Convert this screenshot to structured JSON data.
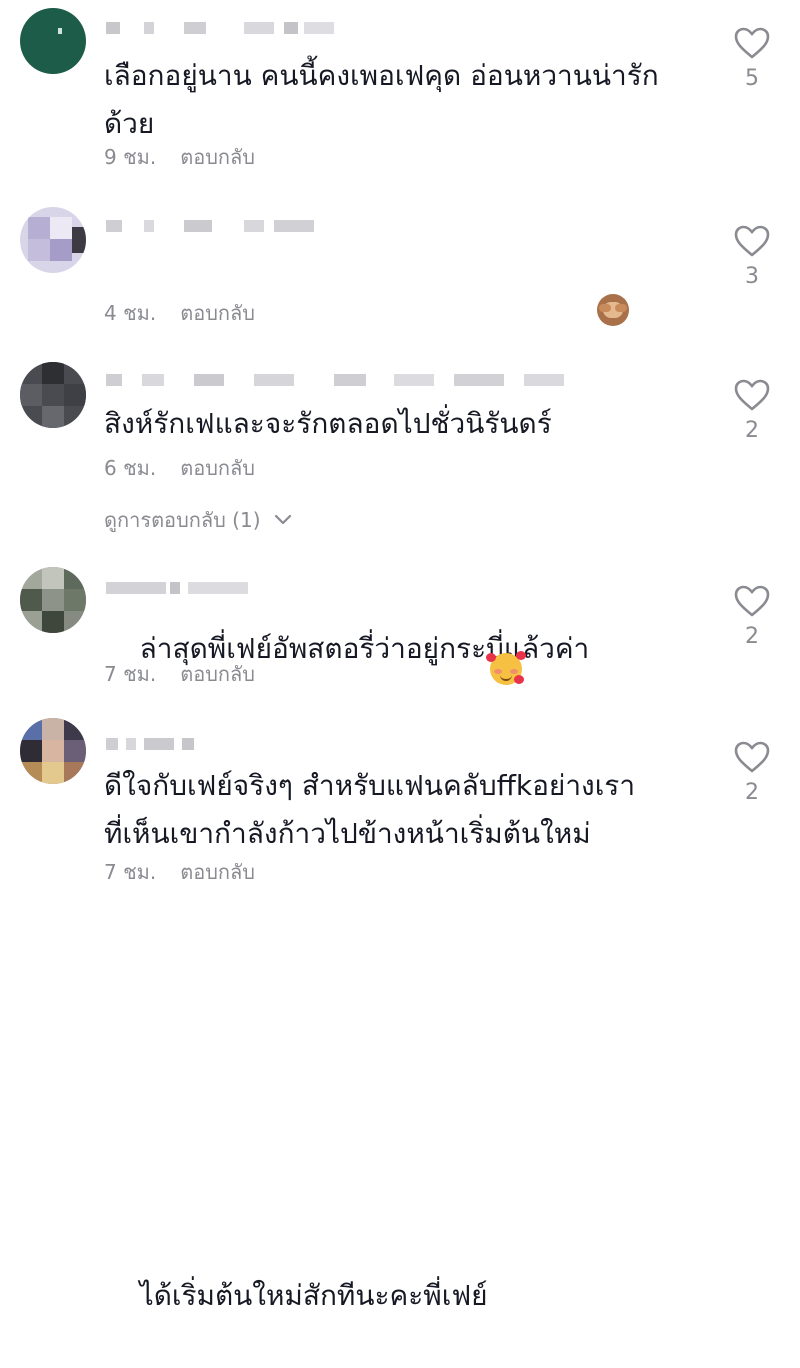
{
  "comments": [
    {
      "text": "เลือกอยู่นาน คนนี้คงเพอเฟคุด อ่อนหวานน่ารัก\nด้วย",
      "time": "9 ชม.",
      "reply_label": "ตอบกลับ",
      "likes": "5"
    },
    {
      "text": "ล่าสุดพี่เฟย์อัพสตอรี่ว่าอยู่กระบี่แล้วค่า",
      "emoji": "see-no-evil-monkey",
      "time": "4 ชม.",
      "reply_label": "ตอบกลับ",
      "likes": "3"
    },
    {
      "text": "สิงห์รักเฟและจะรักตลอดไปชั่วนิรันดร์",
      "time": "6 ชม.",
      "reply_label": "ตอบกลับ",
      "likes": "2",
      "view_replies": "ดูการตอบกลับ (1)"
    },
    {
      "text": "ได้เริ่มต้นใหม่สักทีนะคะพี่เฟย์",
      "emoji": "smiling-face-with-hearts",
      "time": "7 ชม.",
      "reply_label": "ตอบกลับ",
      "likes": "2"
    },
    {
      "text": "ดีใจกับเฟย์จริงๆ สำหรับแฟนคลับffkอย่างเรา\nที่เห็นเขากำลังก้าวไปข้างหน้าเริ่มต้นใหม่",
      "time": "7 ชม.",
      "reply_label": "ตอบกลับ",
      "likes": "2"
    }
  ],
  "icons": {
    "like": "heart-outline-icon",
    "expand": "chevron-down-icon"
  },
  "colors": {
    "text": "#161823",
    "secondary": "#8a8b91",
    "like_stroke": "#8a8b91"
  }
}
